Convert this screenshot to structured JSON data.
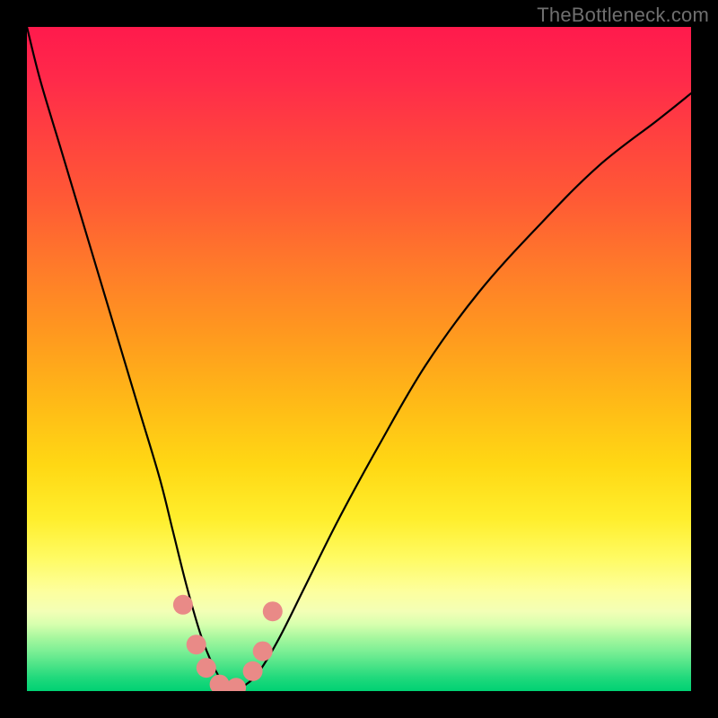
{
  "watermark": "TheBottleneck.com",
  "chart_data": {
    "type": "line",
    "title": "",
    "xlabel": "",
    "ylabel": "",
    "xlim": [
      0,
      100
    ],
    "ylim": [
      0,
      100
    ],
    "grid": false,
    "legend": false,
    "series": [
      {
        "name": "curve",
        "color": "#000000",
        "type": "line",
        "x": [
          0,
          2,
          5,
          8,
          11,
          14,
          17,
          20,
          22,
          24,
          26,
          27.5,
          29,
          30,
          31,
          33,
          35,
          38,
          42,
          47,
          53,
          60,
          68,
          77,
          86,
          95,
          100
        ],
        "y": [
          100,
          92,
          82,
          72,
          62,
          52,
          42,
          32,
          24,
          16,
          9,
          5,
          2,
          0.5,
          0,
          1,
          3,
          8,
          16,
          26,
          37,
          49,
          60,
          70,
          79,
          86,
          90
        ]
      },
      {
        "name": "markers",
        "color": "#e98a87",
        "type": "scatter",
        "x": [
          23.5,
          25.5,
          27,
          29,
          31.5,
          34,
          35.5,
          37
        ],
        "y": [
          13,
          7,
          3.5,
          1,
          0.5,
          3,
          6,
          12
        ]
      }
    ],
    "colors": {
      "gradient_top": "#ff1a4c",
      "gradient_mid": "#ffd814",
      "gradient_bottom": "#00d173",
      "frame": "#000000",
      "marker": "#e98a87"
    }
  }
}
